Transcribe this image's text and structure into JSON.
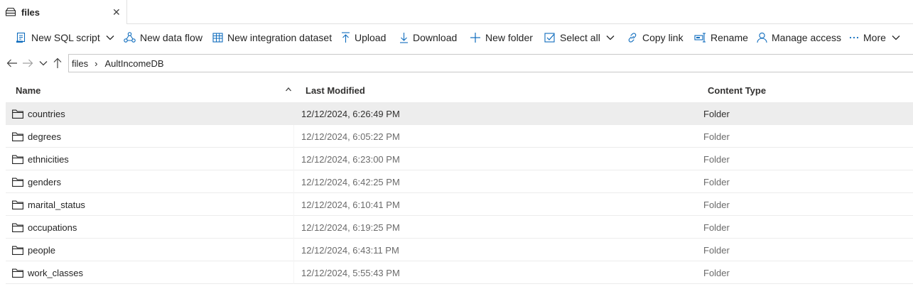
{
  "tab": {
    "label": "files",
    "icon": "storage-stack-icon",
    "close_glyph": "✕"
  },
  "toolbar": {
    "items": [
      {
        "label": "New SQL script",
        "icon": "sql-script-icon",
        "has_dropdown": true
      },
      {
        "label": "New data flow",
        "icon": "data-flow-icon",
        "has_dropdown": false
      },
      {
        "label": "New integration dataset",
        "icon": "table-icon",
        "has_dropdown": false
      },
      {
        "label": "Upload",
        "icon": "upload-icon",
        "has_dropdown": false
      },
      {
        "label": "Download",
        "icon": "download-icon",
        "has_dropdown": false
      },
      {
        "label": "New folder",
        "icon": "plus-icon",
        "has_dropdown": false
      },
      {
        "label": "Select all",
        "icon": "checkbox-icon",
        "has_dropdown": true
      },
      {
        "label": "Copy link",
        "icon": "link-icon",
        "has_dropdown": false
      },
      {
        "label": "Rename",
        "icon": "rename-icon",
        "has_dropdown": false
      },
      {
        "label": "Manage access",
        "icon": "person-icon",
        "has_dropdown": false
      },
      {
        "label": "More",
        "icon": "ellipsis-icon",
        "has_dropdown": true
      }
    ],
    "accent_color": "#0f6cbd"
  },
  "breadcrumb": {
    "items": [
      "files",
      "AultIncomeDB"
    ],
    "separator": "›"
  },
  "table": {
    "columns": {
      "name": "Name",
      "modified": "Last Modified",
      "type": "Content Type"
    },
    "sort": {
      "column": "Name",
      "direction": "ascending"
    },
    "rows": [
      {
        "name": "countries",
        "modified": "12/12/2024, 6:26:49 PM",
        "type": "Folder",
        "selected": true
      },
      {
        "name": "degrees",
        "modified": "12/12/2024, 6:05:22 PM",
        "type": "Folder",
        "selected": false
      },
      {
        "name": "ethnicities",
        "modified": "12/12/2024, 6:23:00 PM",
        "type": "Folder",
        "selected": false
      },
      {
        "name": "genders",
        "modified": "12/12/2024, 6:42:25 PM",
        "type": "Folder",
        "selected": false
      },
      {
        "name": "marital_status",
        "modified": "12/12/2024, 6:10:41 PM",
        "type": "Folder",
        "selected": false
      },
      {
        "name": "occupations",
        "modified": "12/12/2024, 6:19:25 PM",
        "type": "Folder",
        "selected": false
      },
      {
        "name": "people",
        "modified": "12/12/2024, 6:43:11 PM",
        "type": "Folder",
        "selected": false
      },
      {
        "name": "work_classes",
        "modified": "12/12/2024, 5:55:43 PM",
        "type": "Folder",
        "selected": false
      }
    ]
  }
}
